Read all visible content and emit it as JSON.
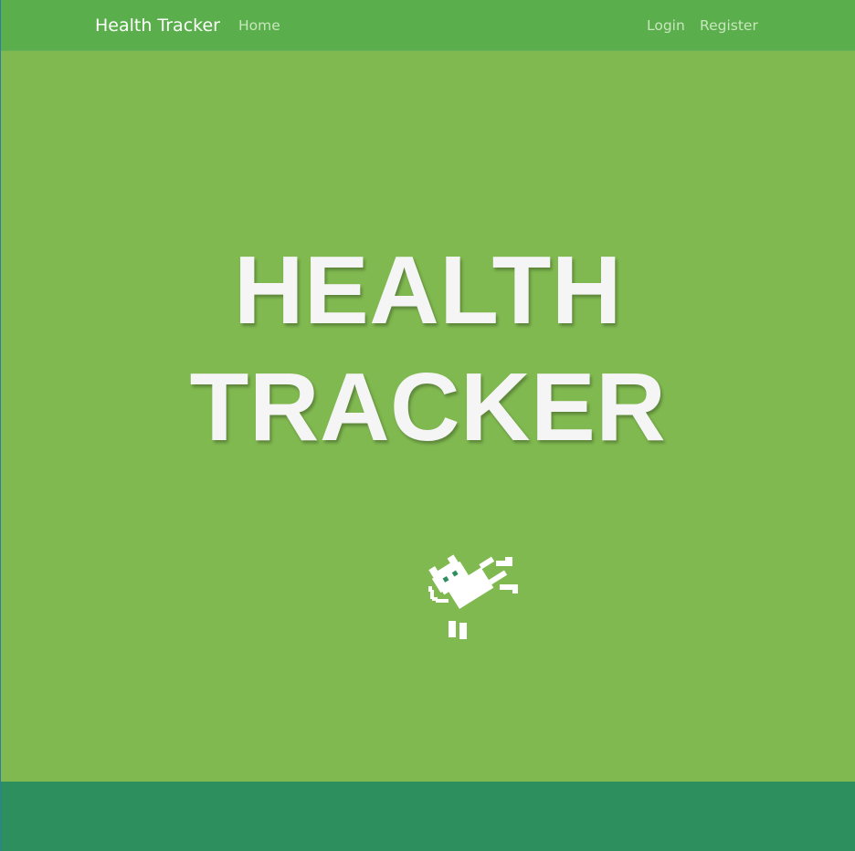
{
  "navbar": {
    "brand": "Health Tracker",
    "links": {
      "home": "Home",
      "login": "Login",
      "register": "Register"
    }
  },
  "hero": {
    "title_line1": "HEALTH",
    "title_line2": "TRACKER",
    "mascot_icon": "pixel-cat-icon"
  },
  "colors": {
    "navbar_bg": "#5aaf4c",
    "hero_bg": "#80b950",
    "footer_bg": "#2d8e5e",
    "title_text": "#f5f5f5",
    "nav_link": "#c8e6bc"
  }
}
